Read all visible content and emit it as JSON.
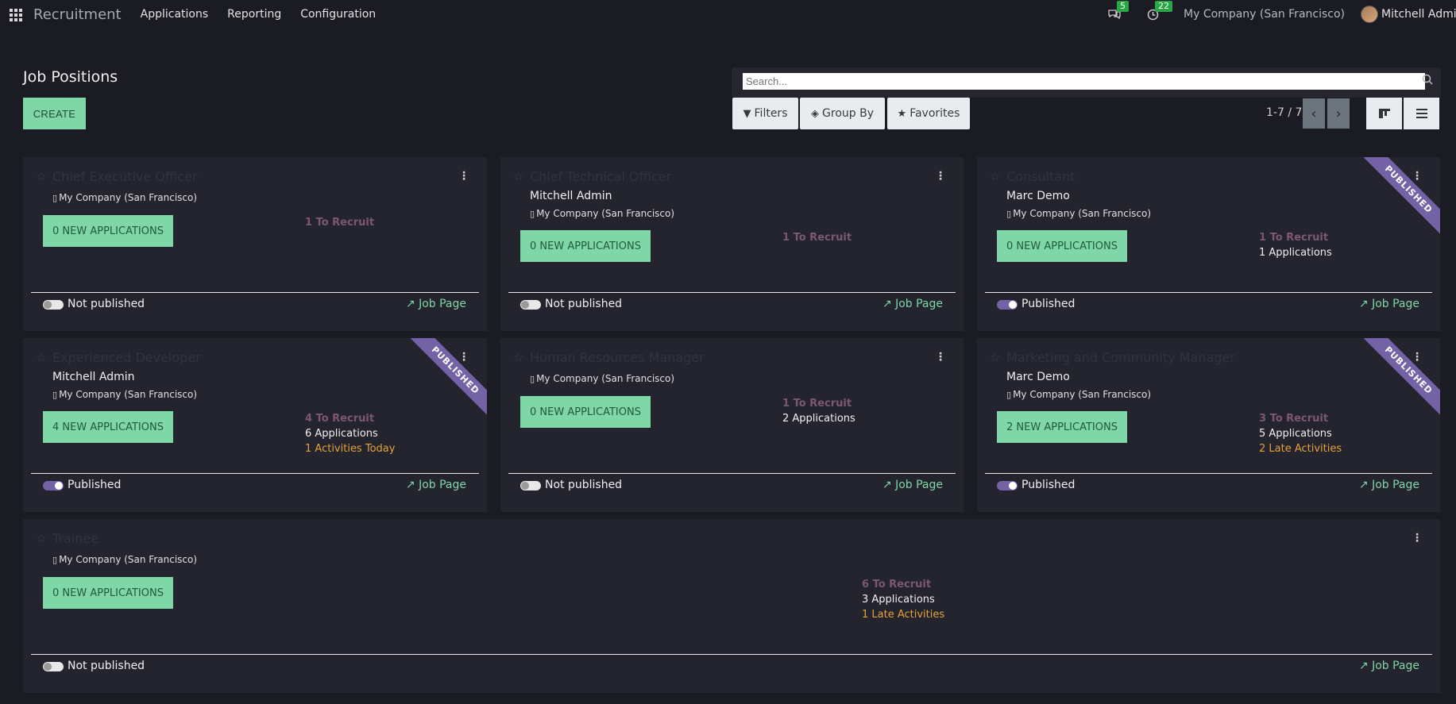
{
  "navbar": {
    "brand": "Recruitment",
    "menu": [
      "Applications",
      "Reporting",
      "Configuration"
    ],
    "messages_count": "5",
    "activities_count": "22",
    "company": "My Company (San Francisco)",
    "user": "Mitchell Admin"
  },
  "control": {
    "title": "Job Positions",
    "create_label": "CREATE",
    "search_placeholder": "Search...",
    "filters_label": "Filters",
    "groupby_label": "Group By",
    "favorites_label": "Favorites",
    "pager": "1-7 / 7"
  },
  "cards": [
    {
      "title": "Chief Executive Officer",
      "responsible": "",
      "company": "My Company (San Francisco)",
      "apps_button": "0 NEW APPLICATIONS",
      "to_recruit": "1 To Recruit",
      "applications": "",
      "activities": "",
      "published": false,
      "status": "Not published",
      "job_page": "Job Page",
      "ribbon": ""
    },
    {
      "title": "Chief Technical Officer",
      "responsible": "Mitchell Admin",
      "company": "My Company (San Francisco)",
      "apps_button": "0 NEW APPLICATIONS",
      "to_recruit": "1 To Recruit",
      "applications": "",
      "activities": "",
      "published": false,
      "status": "Not published",
      "job_page": "Job Page",
      "ribbon": ""
    },
    {
      "title": "Consultant",
      "responsible": "Marc Demo",
      "company": "My Company (San Francisco)",
      "apps_button": "0 NEW APPLICATIONS",
      "to_recruit": "1 To Recruit",
      "applications": "1 Applications",
      "activities": "",
      "published": true,
      "status": "Published",
      "job_page": "Job Page",
      "ribbon": "PUBLISHED"
    },
    {
      "title": "Experienced Developer",
      "responsible": "Mitchell Admin",
      "company": "My Company (San Francisco)",
      "apps_button": "4 NEW APPLICATIONS",
      "to_recruit": "4 To Recruit",
      "applications": "6 Applications",
      "activities": "1 Activities Today",
      "published": true,
      "status": "Published",
      "job_page": "Job Page",
      "ribbon": "PUBLISHED"
    },
    {
      "title": "Human Resources Manager",
      "responsible": "",
      "company": "My Company (San Francisco)",
      "apps_button": "0 NEW APPLICATIONS",
      "to_recruit": "1 To Recruit",
      "applications": "2 Applications",
      "activities": "",
      "published": false,
      "status": "Not published",
      "job_page": "Job Page",
      "ribbon": ""
    },
    {
      "title": "Marketing and Community Manager",
      "responsible": "Marc Demo",
      "company": "My Company (San Francisco)",
      "apps_button": "2 NEW APPLICATIONS",
      "to_recruit": "3 To Recruit",
      "applications": "5 Applications",
      "activities": "2 Late Activities",
      "published": true,
      "status": "Published",
      "job_page": "Job Page",
      "ribbon": "PUBLISHED"
    },
    {
      "title": "Trainee",
      "responsible": "",
      "company": "My Company (San Francisco)",
      "apps_button": "0 NEW APPLICATIONS",
      "to_recruit": "6 To Recruit",
      "applications": "3 Applications",
      "activities": "1 Late Activities",
      "published": false,
      "status": "Not published",
      "job_page": "Job Page",
      "ribbon": ""
    }
  ]
}
